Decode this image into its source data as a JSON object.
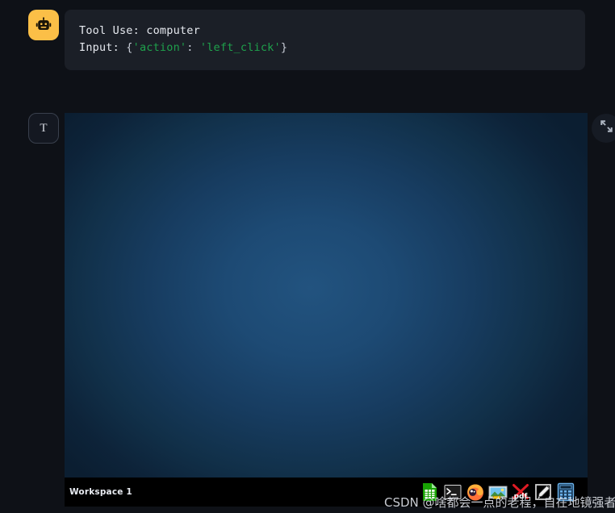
{
  "conversation": {
    "tool_message": {
      "avatar_icon": "robot-icon",
      "line1_label": "Tool Use:",
      "line1_value": "computer",
      "line2_label": "Input:",
      "line2_open_brace": "{",
      "line2_key": "'action'",
      "line2_colon": ": ",
      "line2_value": "'left_click'",
      "line2_close_brace": "}",
      "full_text": "Tool Use: computer\nInput: {'action': 'left_click'}"
    },
    "screenshot_message": {
      "avatar_letter": "T",
      "expand_icon": "expand-arrows-icon",
      "expand_tooltip": "Expand"
    }
  },
  "desktop": {
    "wallpaper_center_color": "#22537f",
    "wallpaper_edge_color": "#0b1e31",
    "taskbar": {
      "background_color": "#000000",
      "workspace_label": "Workspace 1",
      "tray_icons": [
        {
          "name": "libreoffice-calc-icon",
          "title": "LibreOffice Calc"
        },
        {
          "name": "terminal-icon",
          "title": "Terminal"
        },
        {
          "name": "firefox-icon",
          "title": "Firefox"
        },
        {
          "name": "image-viewer-icon",
          "title": "Image Viewer"
        },
        {
          "name": "pdf-viewer-icon",
          "title": "PDF Viewer",
          "label": "pdf"
        },
        {
          "name": "drawing-editor-icon",
          "title": "Drawing Editor"
        },
        {
          "name": "calculator-icon",
          "title": "Calculator"
        }
      ]
    }
  },
  "watermark": {
    "text": "CSDN @啥都会一点的老程，自在地镜强者"
  }
}
